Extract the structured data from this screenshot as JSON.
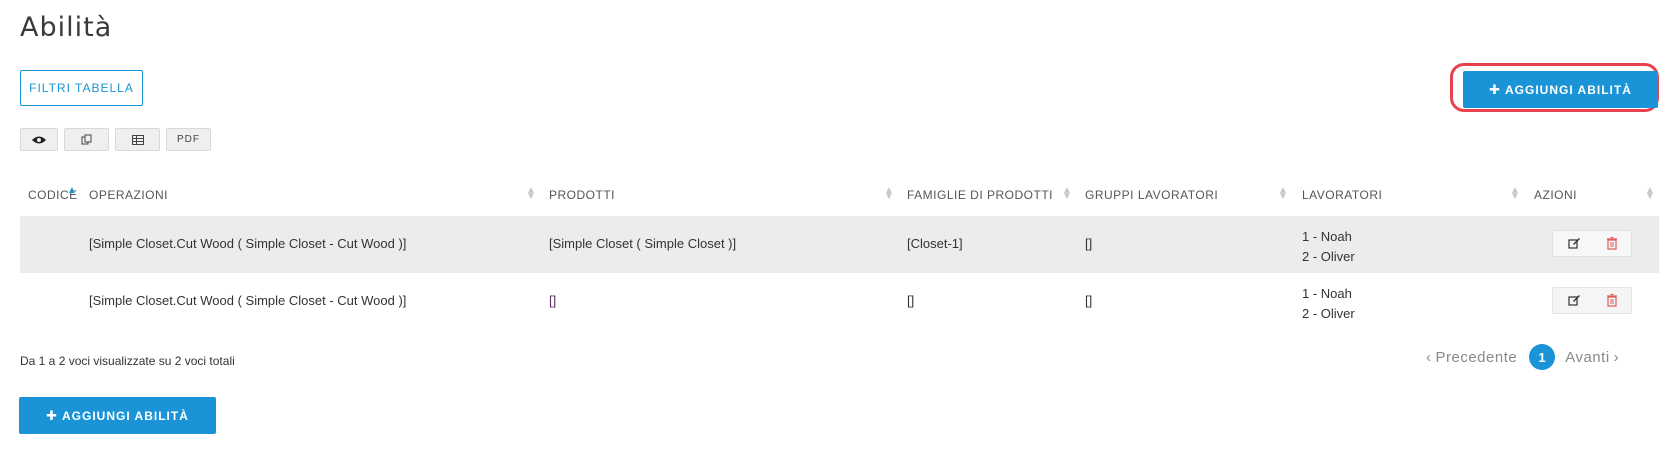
{
  "page": {
    "title": "Abilità"
  },
  "toolbar": {
    "filters_label": "FILTRI TABELLA",
    "add_label": "AGGIUNGI ABILITÀ",
    "add_icon": "plus-icon",
    "export_buttons": [
      {
        "icon": "eye-icon"
      },
      {
        "icon": "copy-icon"
      },
      {
        "icon": "spreadsheet-icon"
      },
      {
        "label": "PDF"
      }
    ]
  },
  "table": {
    "columns": [
      "CODICE",
      "OPERAZIONI",
      "PRODOTTI",
      "FAMIGLIE DI PRODOTTI",
      "GRUPPI LAVORATORI",
      "LAVORATORI",
      "AZIONI"
    ],
    "sorted_column": "CODICE",
    "rows": [
      {
        "code": "",
        "operations": "[Simple Closet.Cut Wood ( Simple Closet - Cut Wood )]",
        "products": "[Simple Closet ( Simple Closet )]",
        "families": "[Closet-1]",
        "groups": "[]",
        "workers": [
          "1 - Noah",
          "2 - Oliver"
        ]
      },
      {
        "code": "",
        "operations": "[Simple Closet.Cut Wood ( Simple Closet - Cut Wood )]",
        "products": "[]",
        "families": "[]",
        "groups": "[]",
        "workers": [
          "1 - Noah",
          "2 - Oliver"
        ]
      }
    ]
  },
  "footer": {
    "summary": "Da 1 a 2 voci visualizzate su 2 voci totali",
    "prev_label": "Precedente",
    "next_label": "Avanti",
    "current_page": "1",
    "add_label": "AGGIUNGI ABILITÀ"
  },
  "colors": {
    "accent": "#1a94d6",
    "highlight": "#e8424f",
    "delete": "#e05a5a"
  }
}
